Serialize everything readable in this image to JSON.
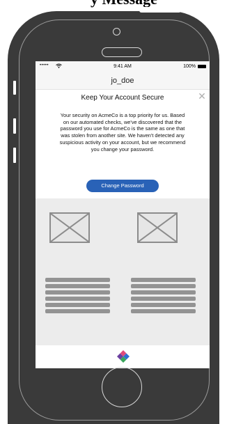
{
  "caption": {
    "text": "y Message"
  },
  "status_bar": {
    "signal": "•••••",
    "time": "9:41 AM",
    "battery_pct": "100%"
  },
  "nav_bar": {
    "title": "jo_doe"
  },
  "alert": {
    "heading": "Keep Your Account Secure",
    "close_glyph": "✕",
    "body": "Your security on AcmeCo is a top priority for us. Based on our automated checks, we've discovered that the password you use for AcmeCo is the same as one that was stolen from another site. We haven't detected any suspicious activity on your account, but we recommend you change your password.",
    "cta_label": "Change Password"
  },
  "colors": {
    "cta": "#2962b7",
    "phone_body": "#3a3a3a",
    "content_bg": "#ececec",
    "placeholder_stroke": "#8c8c8c"
  },
  "icons": [
    "wifi-icon",
    "battery-icon",
    "close-icon",
    "image-placeholder-icon",
    "app-logo-icon"
  ]
}
